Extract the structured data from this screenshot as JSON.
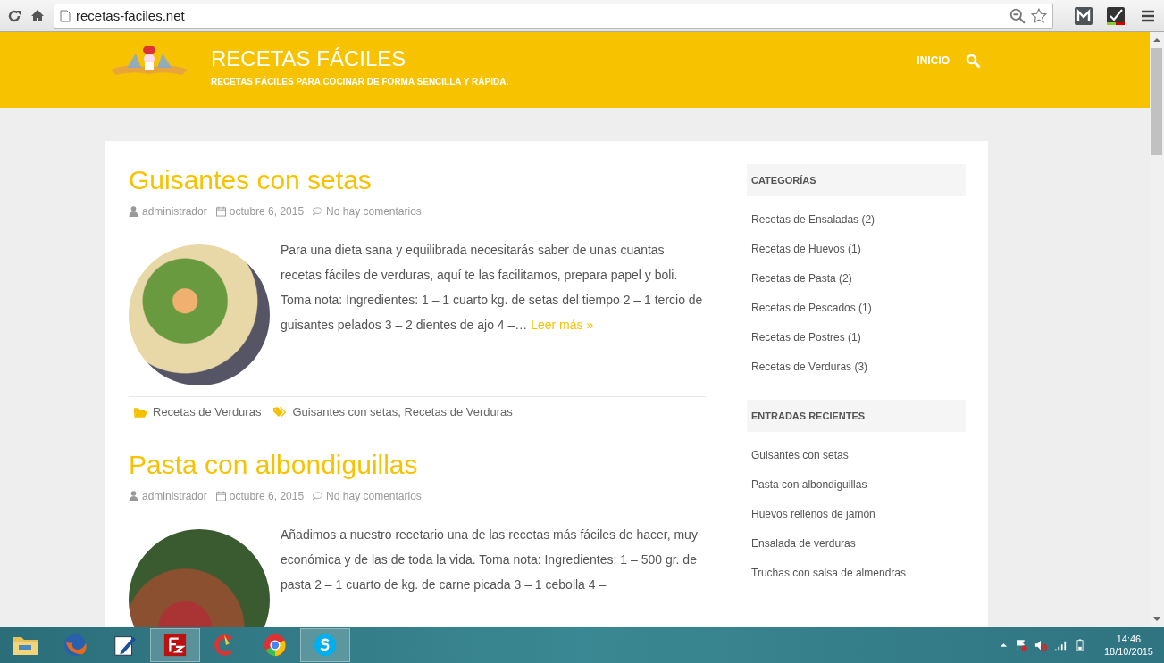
{
  "browser": {
    "url": "recetas-faciles.net"
  },
  "site": {
    "title": "RECETAS FÁCILES",
    "tagline": "RECETAS FÁCILES PARA COCINAR DE FORMA SENCILLA Y RÁPIDA.",
    "nav": [
      {
        "label": "INICIO"
      }
    ]
  },
  "posts": [
    {
      "title": "Guisantes con setas",
      "author": "administrador",
      "date": "octubre 6, 2015",
      "comments": "No hay comentarios",
      "excerpt": "Para una dieta sana y equilibrada necesitarás saber de unas cuantas recetas fáciles de verduras, aquí te las facilitamos, prepara papel y boli. Toma nota: Ingredientes: 1 – 1 cuarto kg. de setas del tiempo 2 – 1 tercio de guisantes pelados 3 – 2 dientes de ajo 4 –…",
      "read_more": "Leer más »",
      "category": "Recetas de Verduras",
      "tags": "Guisantes con setas, Recetas de Verduras"
    },
    {
      "title": "Pasta con albondiguillas",
      "author": "administrador",
      "date": "octubre 6, 2015",
      "comments": "No hay comentarios",
      "excerpt": "Añadimos a nuestro recetario una de las recetas más fáciles de hacer, muy económica y de las de toda la vida. Toma nota: Ingredientes: 1 – 500 gr. de pasta 2 – 1 cuarto de kg. de carne picada 3 – 1 cebolla 4 –"
    }
  ],
  "sidebar": [
    {
      "heading": "CATEGORÍAS",
      "links": [
        "Recetas de Ensaladas (2)",
        "Recetas de Huevos (1)",
        "Recetas de Pasta (2)",
        "Recetas de Pescados (1)",
        "Recetas de Postres (1)",
        "Recetas de Verduras (3)"
      ]
    },
    {
      "heading": "ENTRADAS RECIENTES",
      "links": [
        "Guisantes con setas",
        "Pasta con albondiguillas",
        "Huevos rellenos de jamón",
        "Ensalada de verduras",
        "Truchas con salsa de almendras"
      ]
    }
  ],
  "taskbar": {
    "apps": [
      {
        "kind": "folder",
        "selected": false
      },
      {
        "kind": "fox",
        "selected": false
      },
      {
        "kind": "pen",
        "selected": false
      },
      {
        "kind": "fz",
        "selected": true
      },
      {
        "kind": "brush",
        "selected": false
      },
      {
        "kind": "chrome",
        "selected": false
      },
      {
        "kind": "skype",
        "selected": true
      }
    ],
    "time": "14:46",
    "date": "18/10/2015"
  }
}
